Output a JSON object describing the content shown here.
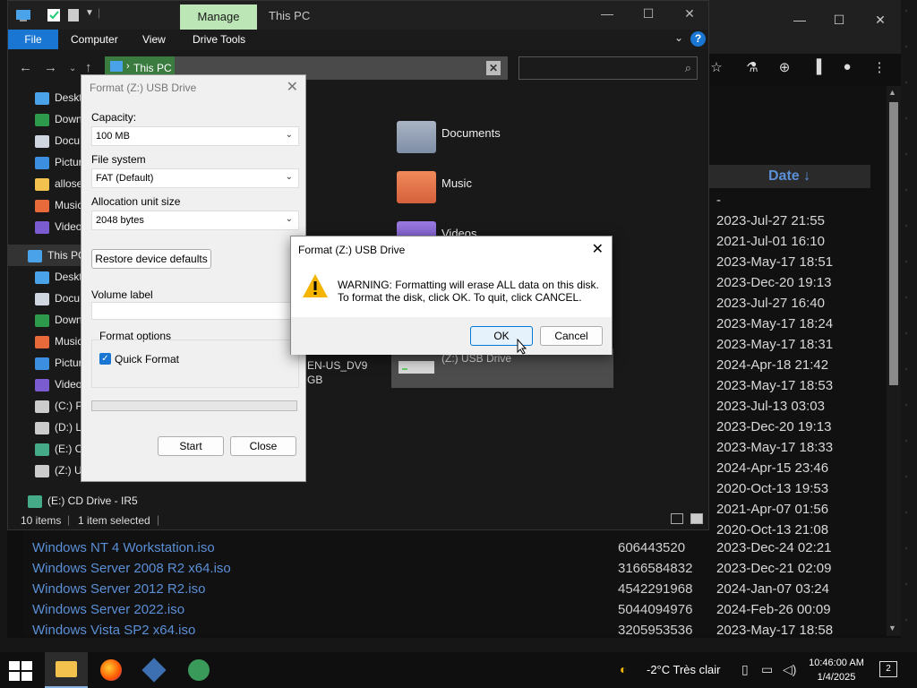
{
  "browser": {
    "date_header": "Date ↓",
    "dates_upper": [
      "-",
      "2023-Jul-27 21:55",
      "2021-Jul-01 16:10",
      "2023-May-17 18:51",
      "2023-Dec-20 19:13",
      "2023-Jul-27 16:40",
      "2023-May-17 18:24",
      "2023-May-17 18:31",
      "2024-Apr-18 21:42",
      "2023-May-17 18:53",
      "2023-Jul-13 03:03",
      "2023-Dec-20 19:13",
      "2023-May-17 18:33",
      "2024-Apr-15 23:46",
      "2020-Oct-13 19:53",
      "2021-Apr-07 01:56",
      "2020-Oct-13 21:08"
    ],
    "files": [
      {
        "name": "Windows NT 4 Workstation.iso",
        "size": "606443520",
        "date": "2023-Dec-24 02:21"
      },
      {
        "name": "Windows Server 2008 R2 x64.iso",
        "size": "3166584832",
        "date": "2023-Dec-21 02:09"
      },
      {
        "name": "Windows Server 2012 R2.iso",
        "size": "4542291968",
        "date": "2024-Jan-07 03:24"
      },
      {
        "name": "Windows Server 2022.iso",
        "size": "5044094976",
        "date": "2024-Feb-26 00:09"
      },
      {
        "name": "Windows Vista SP2 x64.iso",
        "size": "3205953536",
        "date": "2023-May-17 18:58"
      }
    ]
  },
  "explorer": {
    "manage_tab": "Manage",
    "title": "This PC",
    "ribbon": {
      "file": "File",
      "computer": "Computer",
      "view": "View",
      "drive_tools": "Drive Tools"
    },
    "address": "This PC",
    "nav_items": [
      "Deskt",
      "Down",
      "Docu",
      "Pictur",
      "allose",
      "Music",
      "Video",
      "This PC",
      "Deskt",
      "Docu",
      "Down",
      "Music",
      "Pictur",
      "Video",
      "(C:) P",
      "(D:) Lo",
      "(E:) Cl",
      "(Z:) U"
    ],
    "cd_drive": "(E:) CD Drive - IR5",
    "folders": [
      "Documents",
      "Music",
      "Videos"
    ],
    "drive_label": "(Z:) USB Drive",
    "cd_tile_label": "EN-US_DV9",
    "cd_tile_sub": "GB",
    "status": {
      "items": "10 items",
      "selected": "1 item selected"
    }
  },
  "format_dialog": {
    "title": "Format (Z:) USB Drive",
    "capacity_label": "Capacity:",
    "capacity": "100 MB",
    "fs_label": "File system",
    "fs": "FAT (Default)",
    "alloc_label": "Allocation unit size",
    "alloc": "2048 bytes",
    "restore": "Restore device defaults",
    "volume_label": "Volume label",
    "volume_value": "",
    "options_label": "Format options",
    "quick_format": "Quick Format",
    "start": "Start",
    "close": "Close"
  },
  "warning_dialog": {
    "title": "Format (Z:) USB Drive",
    "line1": "WARNING: Formatting will erase ALL data on this disk.",
    "line2": "To format the disk, click OK. To quit, click CANCEL.",
    "ok": "OK",
    "cancel": "Cancel"
  },
  "taskbar": {
    "weather": "-2°C  Très clair",
    "time": "10:46:00 AM",
    "date": "1/4/2025"
  }
}
